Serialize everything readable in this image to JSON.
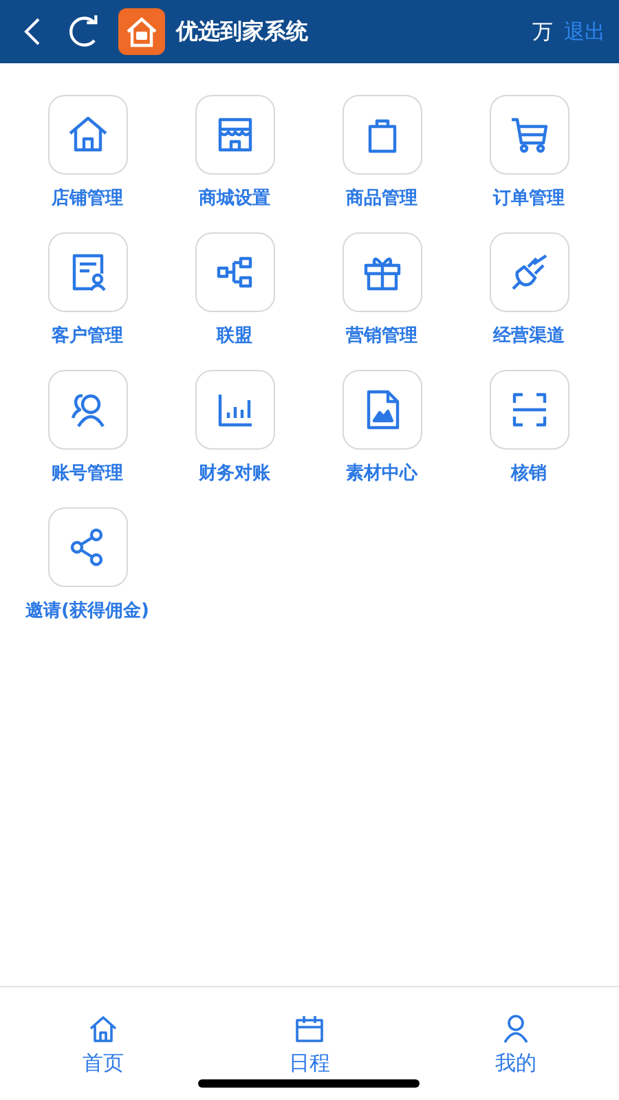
{
  "header": {
    "title": "优选到家系统",
    "user": "万",
    "logout": "退出"
  },
  "menu": [
    {
      "kind": "home",
      "label": "店铺管理"
    },
    {
      "kind": "store",
      "label": "商城设置"
    },
    {
      "kind": "bag",
      "label": "商品管理"
    },
    {
      "kind": "cart",
      "label": "订单管理"
    },
    {
      "kind": "customer",
      "label": "客户管理"
    },
    {
      "kind": "network",
      "label": "联盟"
    },
    {
      "kind": "gift",
      "label": "营销管理"
    },
    {
      "kind": "plug",
      "label": "经营渠道"
    },
    {
      "kind": "users",
      "label": "账号管理"
    },
    {
      "kind": "chart",
      "label": "财务对账"
    },
    {
      "kind": "image",
      "label": "素材中心"
    },
    {
      "kind": "scan",
      "label": "核销"
    },
    {
      "kind": "share",
      "label": "邀请(获得佣金)"
    }
  ],
  "nav": [
    {
      "kind": "home",
      "label": "首页"
    },
    {
      "kind": "calendar",
      "label": "日程"
    },
    {
      "kind": "person",
      "label": "我的"
    }
  ]
}
